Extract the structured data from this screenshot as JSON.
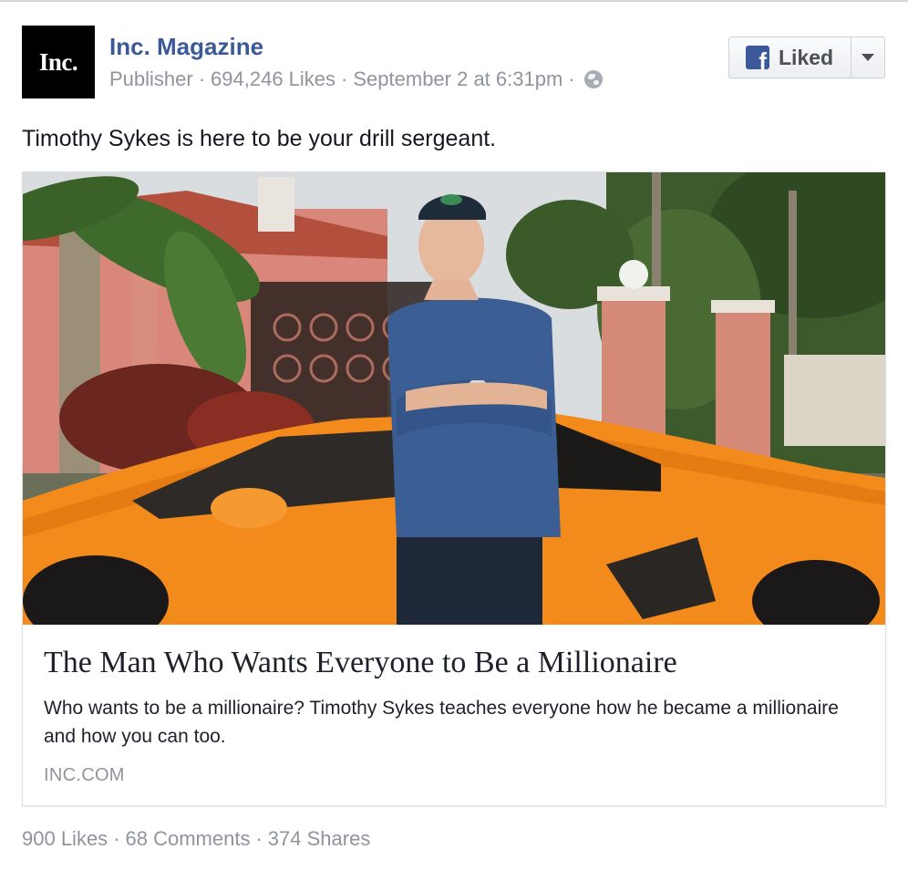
{
  "page": {
    "avatar_text": "Inc.",
    "name": "Inc. Magazine",
    "category": "Publisher",
    "likes": "694,246 Likes",
    "timestamp": "September 2 at 6:31pm",
    "privacy_icon": "globe-icon"
  },
  "like_button": {
    "label": "Liked",
    "logo_letter": "f",
    "icon": "facebook-logo-icon",
    "dropdown_icon": "caret-down-icon"
  },
  "post": {
    "text": "Timothy Sykes is here to be your drill sergeant."
  },
  "link_preview": {
    "title": "The Man Who Wants Everyone to Be a Millionaire",
    "description": "Who wants to be a millionaire? Timothy Sykes teaches everyone how he became a millionaire and how you can too.",
    "domain": "INC.COM"
  },
  "stats": {
    "likes": "900 Likes",
    "comments": "68 Comments",
    "shares": "374 Shares",
    "separator": "·"
  },
  "colors": {
    "brand_blue": "#3b5998",
    "meta_gray": "#90949c",
    "car_orange": "#f28a1c"
  }
}
